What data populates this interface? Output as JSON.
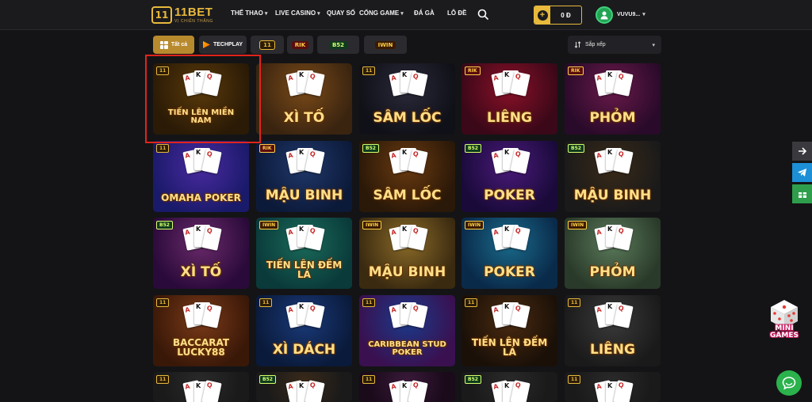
{
  "header": {
    "logo_name": "11BET",
    "logo_tagline": "VỊ CHIẾN THẮNG",
    "nav": [
      {
        "label": "THỂ THAO",
        "has_dropdown": true
      },
      {
        "label": "LIVE CASINO",
        "has_dropdown": true
      },
      {
        "label": "QUAY SỐ",
        "has_dropdown": false
      },
      {
        "label": "CỔNG GAME",
        "has_dropdown": true
      },
      {
        "label": "ĐÁ GÀ",
        "has_dropdown": false
      },
      {
        "label": "LÔ ĐỀ",
        "has_dropdown": false
      }
    ],
    "balance": "0 Đ",
    "username": "VUVU9..."
  },
  "filters": {
    "all_label": "Tất cả",
    "techplay_label": "TECHPLAY",
    "providers": [
      "11",
      "RIK",
      "B52",
      "IWIN"
    ],
    "sort_label": "Sắp xếp"
  },
  "games": [
    {
      "title": "TIẾN LÊN MIỀN NAM",
      "badge": "11"
    },
    {
      "title": "XÌ TỐ",
      "badge": ""
    },
    {
      "title": "SÂM LỐC",
      "badge": "11"
    },
    {
      "title": "LIÊNG",
      "badge": "RIK"
    },
    {
      "title": "PHỎM",
      "badge": "RIK"
    },
    {
      "title": "OMAHA POKER",
      "badge": "11"
    },
    {
      "title": "MẬU BINH",
      "badge": "RIK"
    },
    {
      "title": "SÂM LỐC",
      "badge": "B52"
    },
    {
      "title": "POKER",
      "badge": "B52"
    },
    {
      "title": "MẬU BINH",
      "badge": "B52"
    },
    {
      "title": "XÌ TỐ",
      "badge": "B52"
    },
    {
      "title": "TIẾN LÊN ĐẾM LÁ",
      "badge": "IWIN"
    },
    {
      "title": "MẬU BINH",
      "badge": "IWIN"
    },
    {
      "title": "POKER",
      "badge": "IWIN"
    },
    {
      "title": "PHỎM",
      "badge": "IWIN"
    },
    {
      "title": "BACCARAT LUCKY88",
      "badge": "11"
    },
    {
      "title": "XÌ DÁCH",
      "badge": "11"
    },
    {
      "title": "CARIBBEAN STUD POKER",
      "badge": "11"
    },
    {
      "title": "TIẾN LÊN ĐẾM LÁ",
      "badge": "11"
    },
    {
      "title": "LIÊNG",
      "badge": "11"
    },
    {
      "title": "",
      "badge": "11"
    },
    {
      "title": "",
      "badge": "B52"
    },
    {
      "title": "",
      "badge": "11"
    },
    {
      "title": "",
      "badge": "B52"
    },
    {
      "title": "",
      "badge": "11"
    }
  ],
  "floating": {
    "mini_games_line1": "MINI",
    "mini_games_line2": "GAMES"
  },
  "colors": {
    "accent_gold": "#e8b93c",
    "highlight_red": "#e0241c",
    "chat_green": "#2bb24c",
    "telegram_blue": "#1d8fd6"
  }
}
